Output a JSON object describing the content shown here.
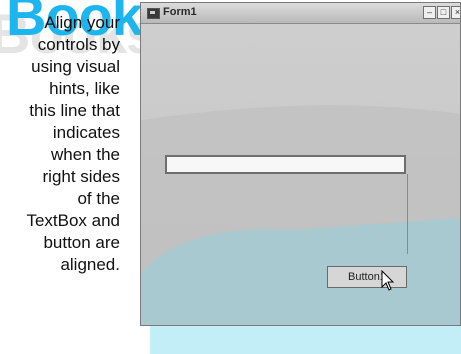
{
  "logo": {
    "text": "Books"
  },
  "caption": {
    "lines": [
      "Align your",
      "controls by",
      "using visual",
      "hints, like",
      "this line that",
      "indicates",
      "when the",
      "right sides",
      "of the",
      "TextBox and",
      "button are",
      "aligned."
    ]
  },
  "window": {
    "title": "Form1",
    "minimize_glyph": "–",
    "maximize_glyph": "□",
    "close_glyph": "×"
  },
  "form": {
    "textbox_value": "",
    "button_label": "Button1"
  },
  "colors": {
    "logo": "#1cb5ee",
    "wave": "#a8c9cf"
  }
}
